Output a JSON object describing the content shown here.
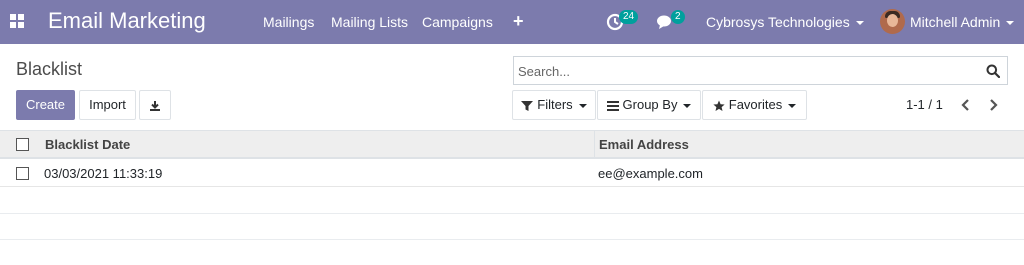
{
  "navbar": {
    "app_title": "Email Marketing",
    "menu": [
      "Mailings",
      "Mailing Lists",
      "Campaigns"
    ],
    "activity_count": "24",
    "messages_count": "2",
    "company": "Cybrosys Technologies",
    "user": "Mitchell Admin"
  },
  "control_panel": {
    "breadcrumb": "Blacklist",
    "search_placeholder": "Search...",
    "create_label": "Create",
    "import_label": "Import",
    "filters_label": "Filters",
    "group_by_label": "Group By",
    "favorites_label": "Favorites",
    "pager": "1-1 / 1"
  },
  "table": {
    "columns": [
      "Blacklist Date",
      "Email Address"
    ],
    "rows": [
      {
        "date": "03/03/2021 11:33:19",
        "email": "ee@example.com"
      }
    ]
  },
  "colors": {
    "brand": "#7c7bad",
    "badge": "#00a09d"
  }
}
